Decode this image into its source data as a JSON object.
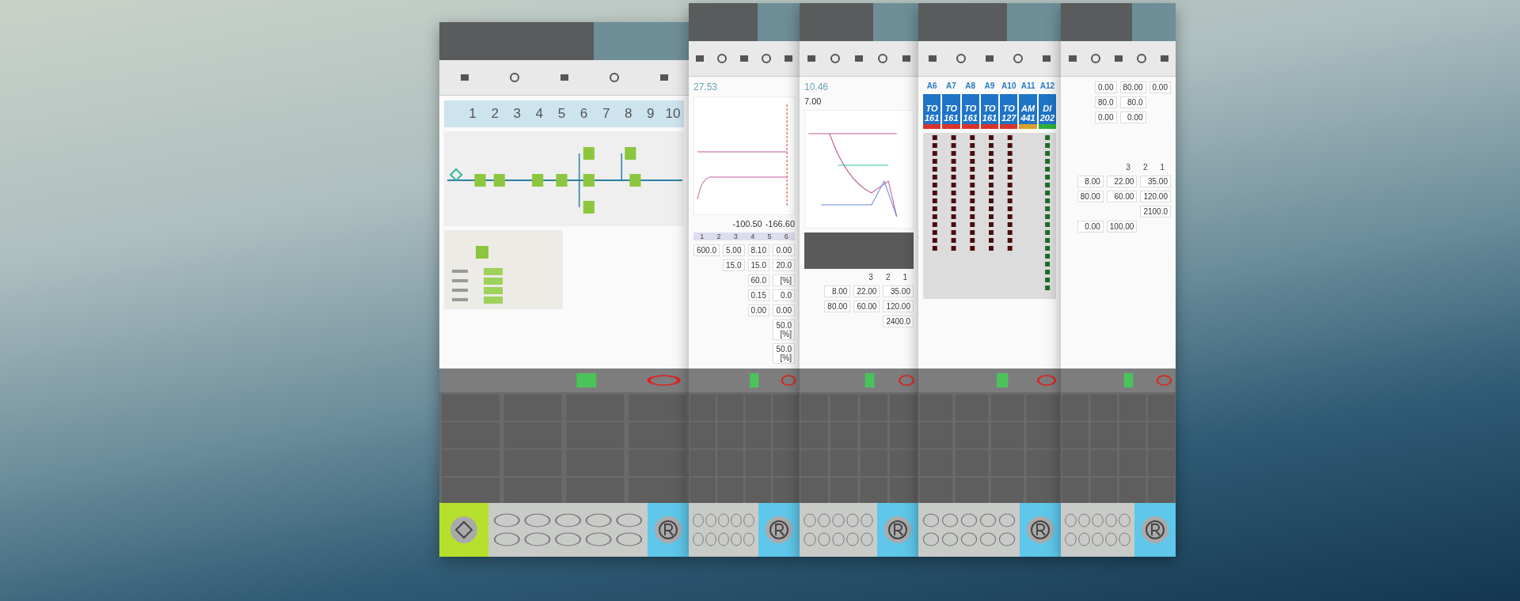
{
  "panels": [
    {
      "kind": "flow",
      "steps": [
        "1",
        "2",
        "3",
        "4",
        "5",
        "6",
        "7",
        "8",
        "9",
        "10"
      ]
    },
    {
      "kind": "curve",
      "title": "27.53",
      "readouts": [
        "-100.50",
        "-166.60"
      ],
      "table_header": [
        "1",
        "2",
        "3",
        "4",
        "5",
        "6"
      ],
      "rows": [
        [
          "600.0",
          "5.00",
          "8.10",
          "0.00"
        ],
        [
          "",
          "15.0",
          "15.0",
          "20.0"
        ],
        [
          "",
          "",
          "60.0",
          "[%]"
        ],
        [
          "",
          "",
          "0.15",
          "0.0"
        ],
        [
          "",
          "",
          "0.00",
          "0.00"
        ],
        [
          "",
          "",
          "",
          "50.0 [%]"
        ],
        [
          "",
          "",
          "",
          "50.0 [%]"
        ]
      ]
    },
    {
      "kind": "speed",
      "title": "10.46",
      "marker": "7.00",
      "stages": [
        "3",
        "2",
        "1"
      ],
      "rows": [
        [
          "8.00",
          "22.00",
          "35.00"
        ],
        [
          "80.00",
          "60.00",
          "120.00"
        ],
        [
          "",
          "",
          "2400.0"
        ]
      ]
    },
    {
      "kind": "io",
      "axes": [
        "A6",
        "A7",
        "A8",
        "A9",
        "A10",
        "A11",
        "A12"
      ],
      "modules": [
        {
          "label": "TO 161",
          "color": "#d9342b"
        },
        {
          "label": "TO 161",
          "color": "#d9342b"
        },
        {
          "label": "TO 161",
          "color": "#d9342b"
        },
        {
          "label": "TO 161",
          "color": "#d9342b"
        },
        {
          "label": "TO 127",
          "color": "#d9342b"
        },
        {
          "label": "AM 441",
          "color": "#d9a12b"
        },
        {
          "label": "DI 202",
          "color": "#2fae3a"
        }
      ]
    },
    {
      "kind": "params",
      "stages": [
        "3",
        "2",
        "1"
      ],
      "rows": [
        [
          "0.00",
          "80.00",
          "0.00"
        ],
        [
          "80.0",
          "80.0",
          ""
        ],
        [
          "0.00",
          "0.00",
          ""
        ],
        [
          "8.00",
          "22.00",
          "35.00"
        ],
        [
          "80.00",
          "60.00",
          "120.00"
        ],
        [
          "",
          "",
          "2100.0"
        ],
        [
          "0.00",
          "100.00",
          ""
        ]
      ]
    }
  ]
}
